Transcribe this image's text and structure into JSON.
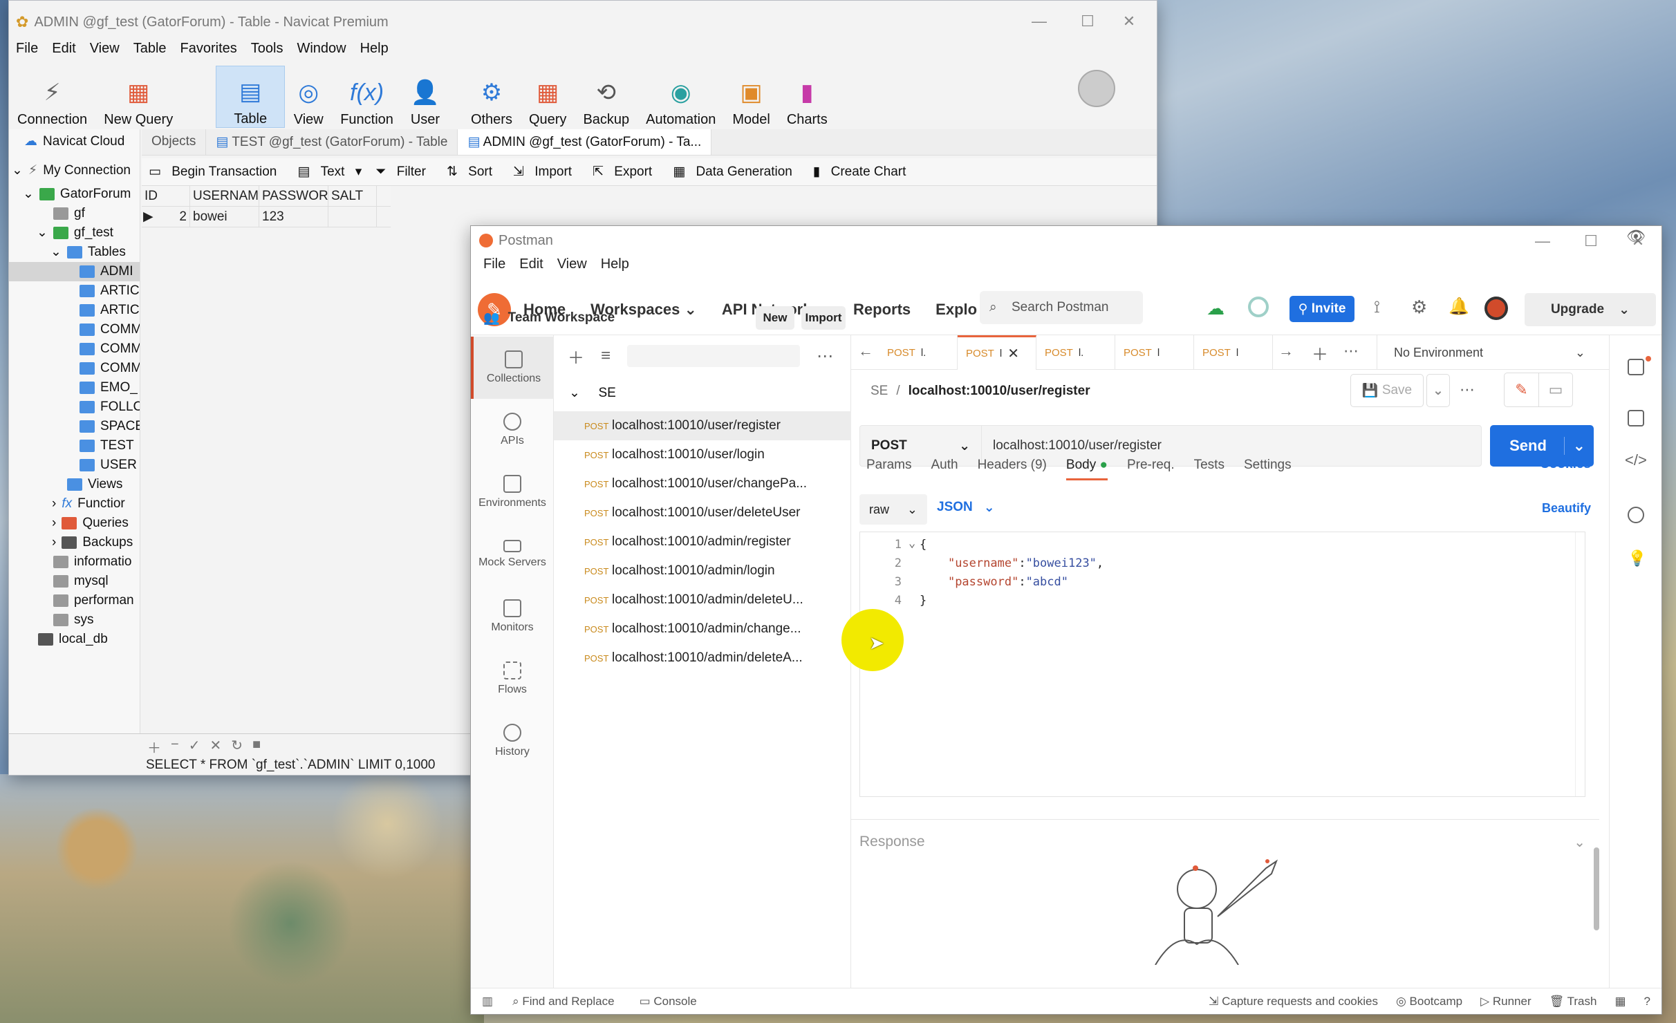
{
  "navicat": {
    "title": "ADMIN @gf_test (GatorForum) - Table - Navicat Premium",
    "menu": [
      "File",
      "Edit",
      "View",
      "Table",
      "Favorites",
      "Tools",
      "Window",
      "Help"
    ],
    "toolbar": [
      "Connection",
      "New Query",
      "Table",
      "View",
      "Function",
      "User",
      "Others",
      "Query",
      "Backup",
      "Automation",
      "Model",
      "Charts"
    ],
    "tree": {
      "cloud": "Navicat Cloud",
      "my_connection": "My Connection",
      "conn": "GatorForum",
      "items": [
        "gf",
        "gf_test",
        "Tables",
        "ADMI",
        "ARTIC",
        "ARTIC",
        "COMM",
        "COMM",
        "COMM",
        "EMO_",
        "FOLLC",
        "SPACE",
        "TEST",
        "USER",
        "Views",
        "Functior",
        "Queries",
        "Backups",
        "informatio",
        "mysql",
        "performan",
        "sys",
        "local_db"
      ]
    },
    "tabs": [
      "Objects",
      "TEST @gf_test (GatorForum) - Table",
      "ADMIN @gf_test (GatorForum) - Ta..."
    ],
    "table_toolbar": [
      "Begin Transaction",
      "Text",
      "Filter",
      "Sort",
      "Import",
      "Export",
      "Data Generation",
      "Create Chart"
    ],
    "columns": [
      "ID",
      "USERNAMI",
      "PASSWORI",
      "SALT"
    ],
    "rows": [
      [
        "2",
        "bowei",
        "123",
        ""
      ]
    ],
    "sql": "SELECT * FROM `gf_test`.`ADMIN` LIMIT 0,1000"
  },
  "postman": {
    "title": "Postman",
    "menu": [
      "File",
      "Edit",
      "View",
      "Help"
    ],
    "nav": [
      "Home",
      "Workspaces",
      "API Network",
      "Reports",
      "Explo"
    ],
    "search_placeholder": "Search Postman",
    "invite": "Invite",
    "upgrade": "Upgrade",
    "workspace": "Team Workspace",
    "new_btn": "New",
    "import_btn": "Import",
    "sidebar": [
      "Collections",
      "APIs",
      "Environments",
      "Mock Servers",
      "Monitors",
      "Flows",
      "History"
    ],
    "collection": "SE",
    "requests": [
      {
        "method": "POST",
        "url": "localhost:10010/user/register"
      },
      {
        "method": "POST",
        "url": "localhost:10010/user/login"
      },
      {
        "method": "POST",
        "url": "localhost:10010/user/changePa..."
      },
      {
        "method": "POST",
        "url": "localhost:10010/user/deleteUser"
      },
      {
        "method": "POST",
        "url": "localhost:10010/admin/register"
      },
      {
        "method": "POST",
        "url": "localhost:10010/admin/login"
      },
      {
        "method": "POST",
        "url": "localhost:10010/admin/deleteU..."
      },
      {
        "method": "POST",
        "url": "localhost:10010/admin/change..."
      },
      {
        "method": "POST",
        "url": "localhost:10010/admin/deleteA..."
      }
    ],
    "open_tabs": [
      {
        "method": "POST",
        "label": "l."
      },
      {
        "method": "POST",
        "label": "l"
      },
      {
        "method": "POST",
        "label": "l."
      },
      {
        "method": "POST",
        "label": "l"
      },
      {
        "method": "POST",
        "label": "l"
      }
    ],
    "environment": "No Environment",
    "breadcrumb_parent": "SE",
    "breadcrumb_current": "localhost:10010/user/register",
    "save": "Save",
    "method": "POST",
    "url": "localhost:10010/user/register",
    "send": "Send",
    "req_tabs": [
      "Params",
      "Auth",
      "Headers (9)",
      "Body",
      "Pre-req.",
      "Tests",
      "Settings"
    ],
    "cookies": "Cookies",
    "body_mode": "raw",
    "body_type": "JSON",
    "beautify": "Beautify",
    "code_lines": [
      "1",
      "2",
      "3",
      "4"
    ],
    "body": {
      "k1": "\"username\"",
      "v1": "\"bowei123\"",
      "k2": "\"password\"",
      "v2": "\"abcd\""
    },
    "response": "Response",
    "status_bar": [
      "Find and Replace",
      "Console",
      "Capture requests and cookies",
      "Bootcamp",
      "Runner",
      "Trash"
    ]
  }
}
